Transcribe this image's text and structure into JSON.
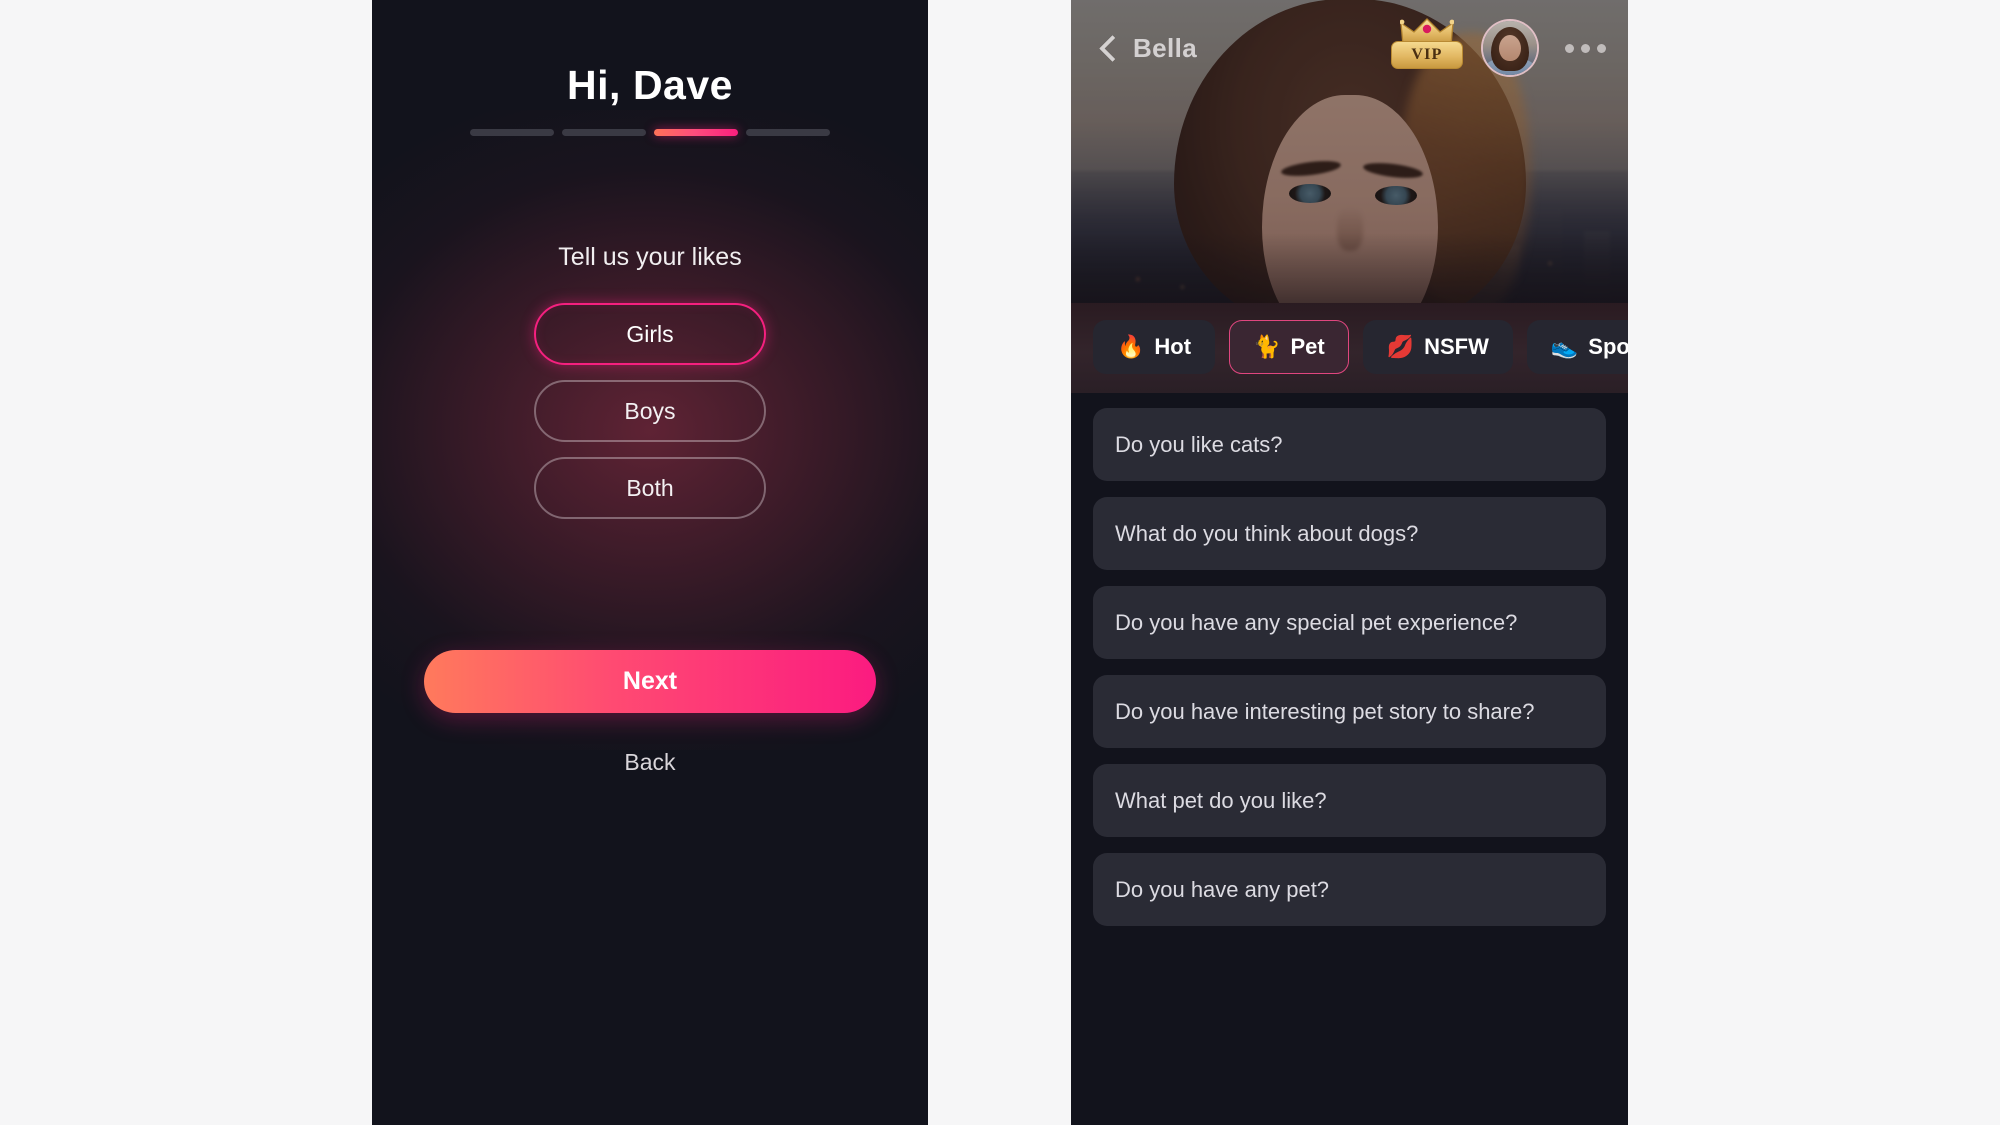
{
  "onboarding": {
    "greeting_prefix": "Hi,",
    "user_name": "Dave",
    "progress": {
      "total": 4,
      "active_index": 3
    },
    "question_title": "Tell us your likes",
    "options": [
      {
        "label": "Girls",
        "selected": true
      },
      {
        "label": "Boys",
        "selected": false
      },
      {
        "label": "Both",
        "selected": false
      }
    ],
    "primary_button": "Next",
    "secondary_button": "Back",
    "colors": {
      "accent_start": "#ff7a5c",
      "accent_end": "#fb1b80",
      "selected_border": "#f5207f",
      "panel_bg": "#12131c"
    }
  },
  "chat": {
    "header": {
      "back_icon": "chevron-left-icon",
      "name": "Bella",
      "vip_label": "VIP",
      "vip_icon": "crown-icon",
      "avatar_icon": "avatar-image",
      "more_icon": "more-horizontal-icon"
    },
    "tabs": [
      {
        "label": "Hot",
        "emoji": "🔥",
        "selected": false
      },
      {
        "label": "Pet",
        "emoji": "🐈",
        "selected": true
      },
      {
        "label": "NSFW",
        "emoji": "💋",
        "selected": false
      },
      {
        "label": "Sports",
        "emoji": "👟",
        "selected": false
      }
    ],
    "questions": [
      "Do you like cats?",
      "What do you think about dogs?",
      "Do you have any special pet experience?",
      "Do you have interesting pet story to share?",
      "What pet do you like?",
      "Do you have any pet?"
    ],
    "colors": {
      "tab_selected_border": "#e0467f",
      "tab_bg": "#262630",
      "card_bg": "#2a2b35",
      "panel_bg": "#12131c"
    }
  }
}
